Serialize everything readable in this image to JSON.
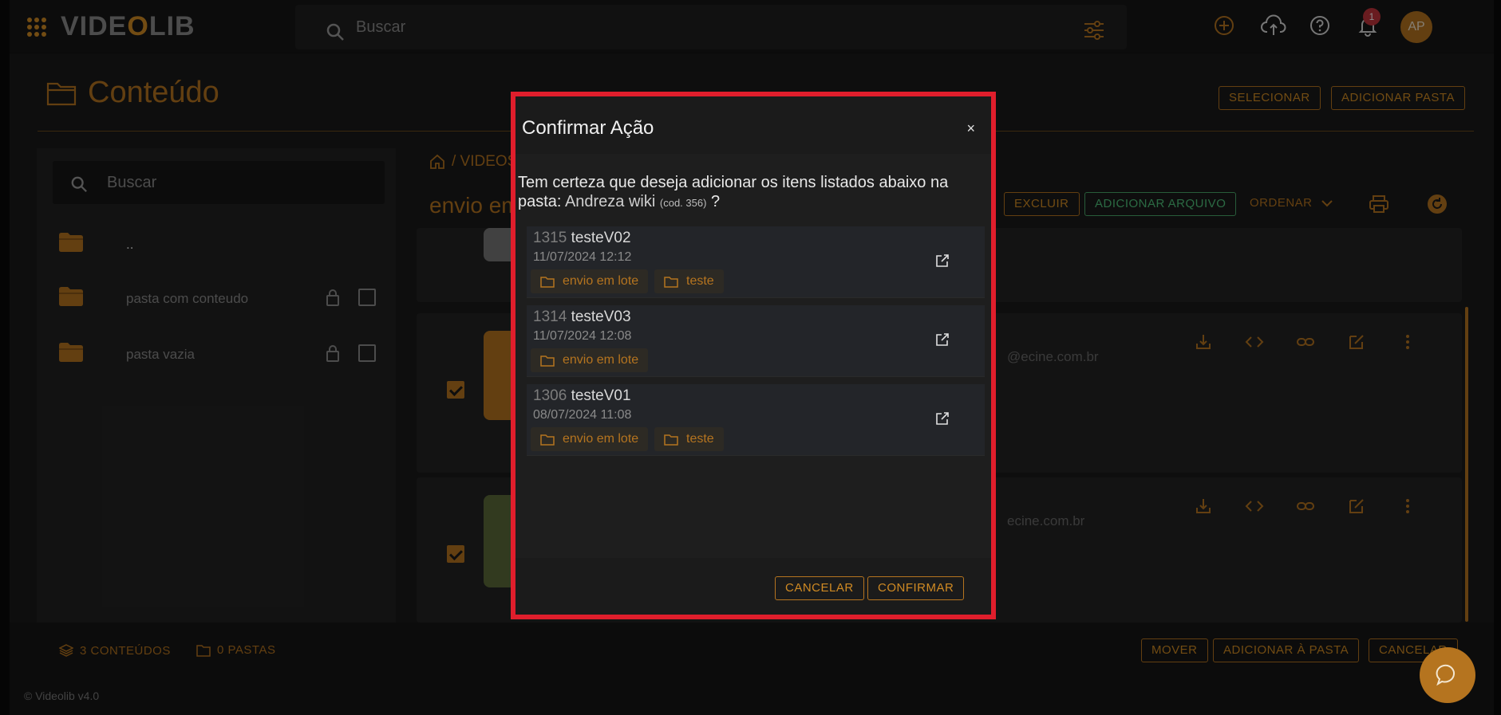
{
  "app": {
    "logo_text_a": "VIDE",
    "logo_text_b": "O",
    "logo_text_c": "LIB"
  },
  "topbar": {
    "search_placeholder": "Buscar",
    "notification_count": "1",
    "avatar_initials": "AP"
  },
  "page": {
    "title": "Conteúdo",
    "select_label": "SELECIONAR",
    "add_folder_label": "ADICIONAR PASTA"
  },
  "sidebar": {
    "search_placeholder": "Buscar",
    "items": [
      {
        "label": ".."
      },
      {
        "label": "pasta com conteudo"
      },
      {
        "label": "pasta vazia"
      }
    ]
  },
  "content": {
    "breadcrumb": "/ VIDEOS",
    "folder_title": "envio em lote",
    "delete_label": "EXCLUIR",
    "add_file_label": "ADICIONAR ARQUIVO",
    "sort_label": "ORDENAR",
    "email_1": "@ecine.com.br",
    "email_2": "ecine.com.br"
  },
  "bottom": {
    "contents_count": "3 CONTEÚDOS",
    "folders_count": "0 PASTAS",
    "move_label": "MOVER",
    "add_to_folder_label": "ADICIONAR À PASTA",
    "cancel_label": "CANCELAR",
    "version": "© Videolib v4.0"
  },
  "modal": {
    "title": "Confirmar Ação",
    "close": "×",
    "message": "Tem certeza que deseja adicionar os itens listados abaixo na pasta:",
    "folder_name": "Andreza wiki",
    "folder_code": "(cod. 356)",
    "question_mark": "?",
    "items": [
      {
        "code": "1315",
        "name": "testeV02",
        "date": "11/07/2024 12:12",
        "tags": [
          "envio em lote",
          "teste"
        ]
      },
      {
        "code": "1314",
        "name": "testeV03",
        "date": "11/07/2024 12:08",
        "tags": [
          "envio em lote"
        ]
      },
      {
        "code": "1306",
        "name": "testeV01",
        "date": "08/07/2024 11:08",
        "tags": [
          "envio em lote",
          "teste"
        ]
      }
    ],
    "cancel_label": "CANCELAR",
    "confirm_label": "CONFIRMAR"
  },
  "colors": {
    "accent": "#b5741f",
    "highlight_border": "#e01e2c",
    "green": "#4fc27a"
  }
}
